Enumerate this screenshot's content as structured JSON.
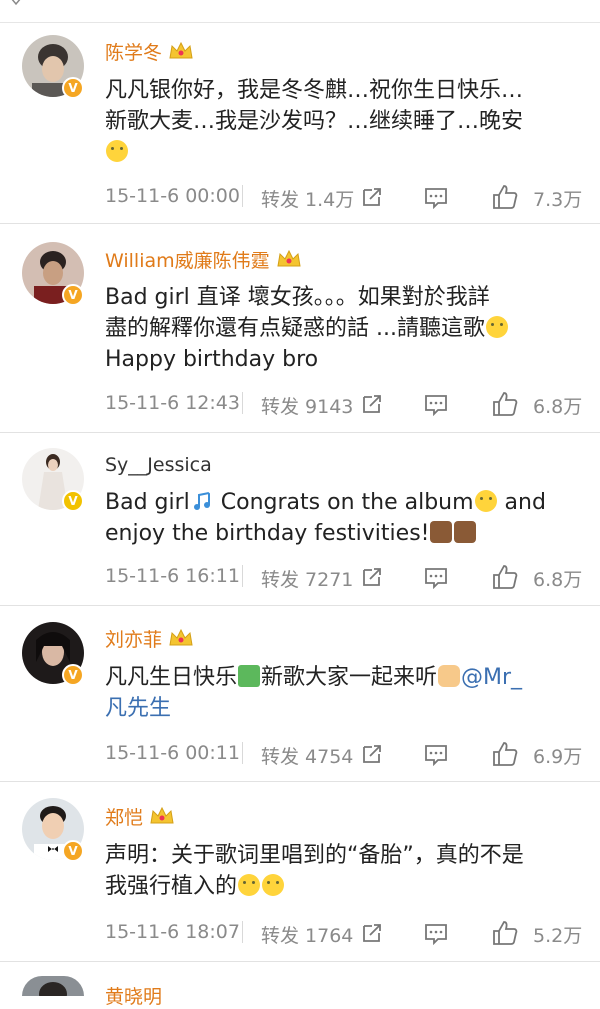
{
  "comments": [
    {
      "name": "陈学冬",
      "text_line1": "凡凡银你好，我是冬冬麒…祝你生日快乐…",
      "text_line2": "新歌大麦…我是沙发吗？…继续睡了…晚安",
      "time": "15-11-6 00:00",
      "repost": "转发 1.4万",
      "likes": "7.3万"
    },
    {
      "name": "William威廉陈伟霆",
      "text_line1": "Bad girl 直译 壞女孩。。。如果對於我詳",
      "text_line2": "盡的解釋你還有点疑惑的話 ...請聽這歌",
      "text_line3": "Happy birthday bro",
      "time": "15-11-6 12:43",
      "repost": "转发 9143",
      "likes": "6.8万"
    },
    {
      "name": "Sy__Jessica",
      "text_line1a": "Bad girl",
      "text_line1b": " Congrats on the album",
      "text_line1c": " and",
      "text_line2": "enjoy the birthday festivities!",
      "time": "15-11-6 16:11",
      "repost": "转发 7271",
      "likes": "6.8万"
    },
    {
      "name": "刘亦菲",
      "text_line1a": "凡凡生日快乐",
      "text_line1b": "新歌大家一起来听",
      "mention": "@Mr_",
      "mention2": "凡先生",
      "time": "15-11-6 00:11",
      "repost": "转发 4754",
      "likes": "6.9万"
    },
    {
      "name": "郑恺",
      "text_line1": "声明：关于歌词里唱到的“备胎”，真的不是",
      "text_line2": "我强行植入的",
      "time": "15-11-6 18:07",
      "repost": "转发 1764",
      "likes": "5.2万"
    }
  ],
  "next_name": "黄晓明",
  "icons": {
    "verified": "verified-v-badge",
    "crown": "crown-icon",
    "share": "share-icon",
    "comment": "comment-icon",
    "like": "thumbs-up-icon"
  }
}
